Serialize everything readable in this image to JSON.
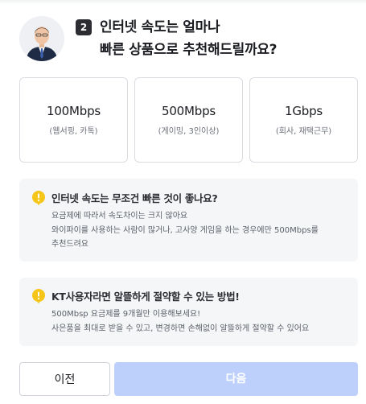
{
  "header": {
    "step_number": "2",
    "question_line1": "인터넷 속도는 얼마나",
    "question_line2": "빠른 상품으로 추천해드릴까요?"
  },
  "options": [
    {
      "title": "100Mbps",
      "subtitle": "(웹서핑, 카톡)"
    },
    {
      "title": "500Mbps",
      "subtitle": "(게이밍, 3인이상)"
    },
    {
      "title": "1Gbps",
      "subtitle": "(회사, 재택근무)"
    }
  ],
  "tips": [
    {
      "title": "인터넷 속도는 무조건 빠른 것이 좋나요?",
      "lines": [
        "요금제에 따라서 속도차이는 크지 않아요",
        "와이파이를 사용하는 사람이 많거나, 고사양 게임을 하는 경우에만 500Mbps를",
        "추천드려요"
      ]
    },
    {
      "title": "KT사용자라면 알뜰하게 절약할 수 있는 방법!",
      "lines": [
        "500Mbsp 요금제를 9개월만 이용해보세요!",
        "사은품을 최대로 받을 수 있고, 변경하면 손해없이 알뜰하게 절약할 수 있어요"
      ]
    }
  ],
  "buttons": {
    "prev_label": "이전",
    "next_label": "다음"
  },
  "colors": {
    "tip_icon": "#f5c518",
    "next_button": "#bcd0fb",
    "step_badge": "#2b2d33"
  }
}
